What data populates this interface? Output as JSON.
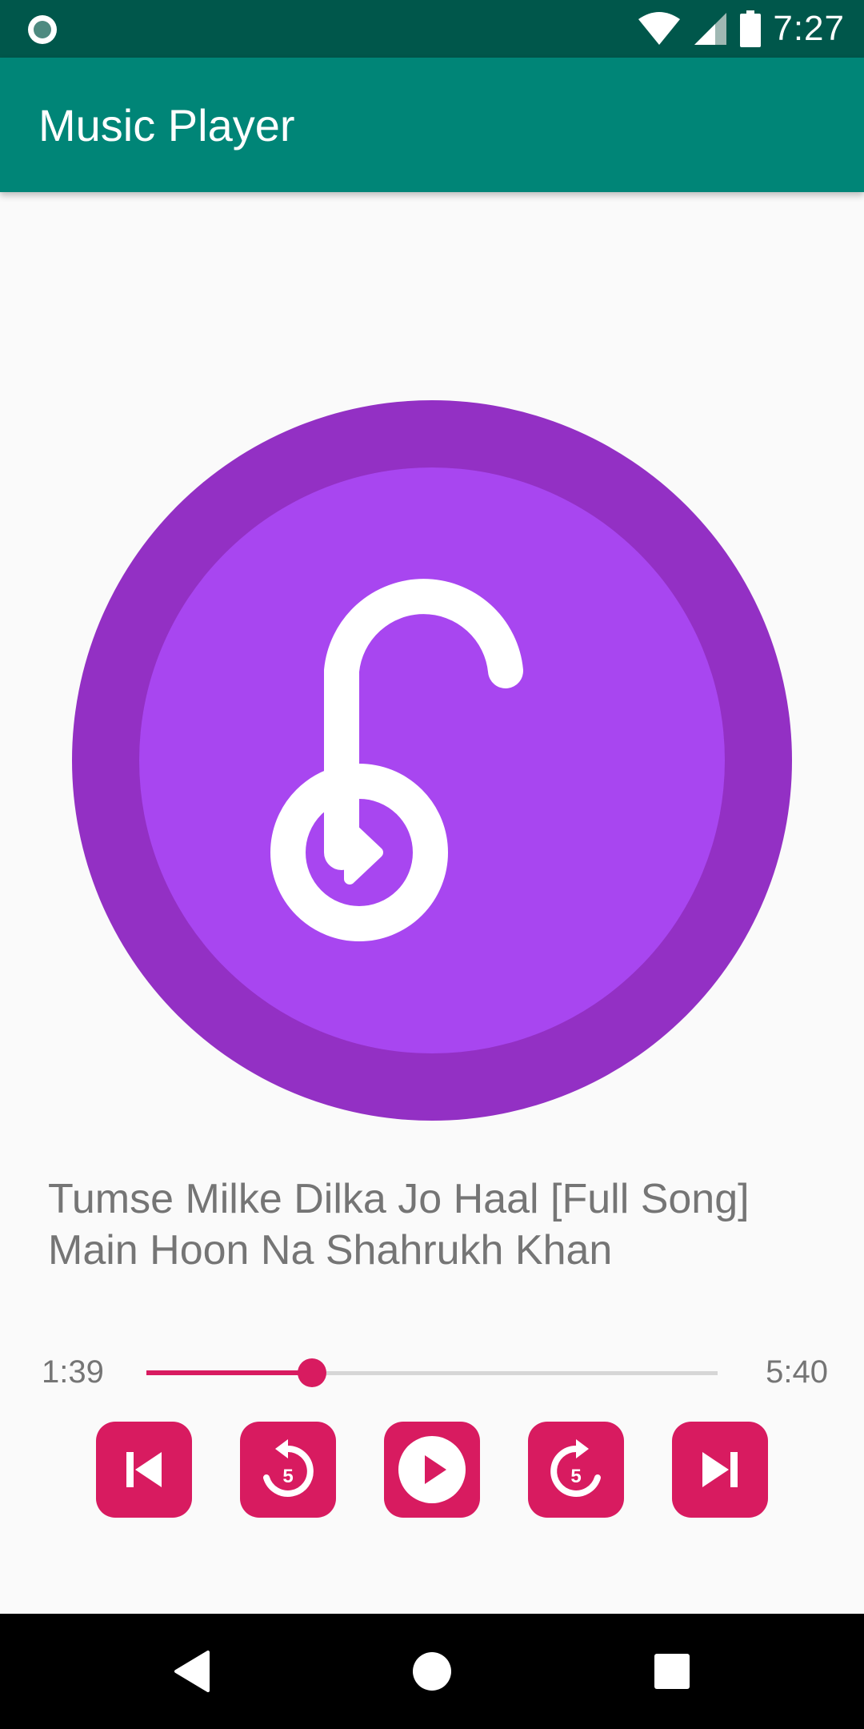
{
  "status_bar": {
    "time": "7:27",
    "icons": [
      "notification-dot-icon",
      "wifi-icon",
      "cellular-signal-icon",
      "battery-icon"
    ],
    "background_color": "#00574b"
  },
  "app_bar": {
    "title": "Music Player",
    "background_color": "#008577"
  },
  "player": {
    "album_art_icon": "music-note-play-icon",
    "album_art_colors": {
      "outer": "#9330c4",
      "inner": "#a846f0"
    },
    "song_title": "Tumse Milke Dilka Jo Haal [Full Song] Main Hoon Na Shahrukh Khan",
    "elapsed_time": "1:39",
    "total_time": "5:40",
    "progress_fraction": 0.29,
    "accent_color": "#d81b60",
    "rewind_seconds": "5",
    "forward_seconds": "5",
    "controls": [
      "skip-previous-icon",
      "rewind-5-icon",
      "play-icon",
      "forward-5-icon",
      "skip-next-icon"
    ]
  },
  "nav_bar": {
    "buttons": [
      "back-icon",
      "home-icon",
      "recents-icon"
    ]
  }
}
